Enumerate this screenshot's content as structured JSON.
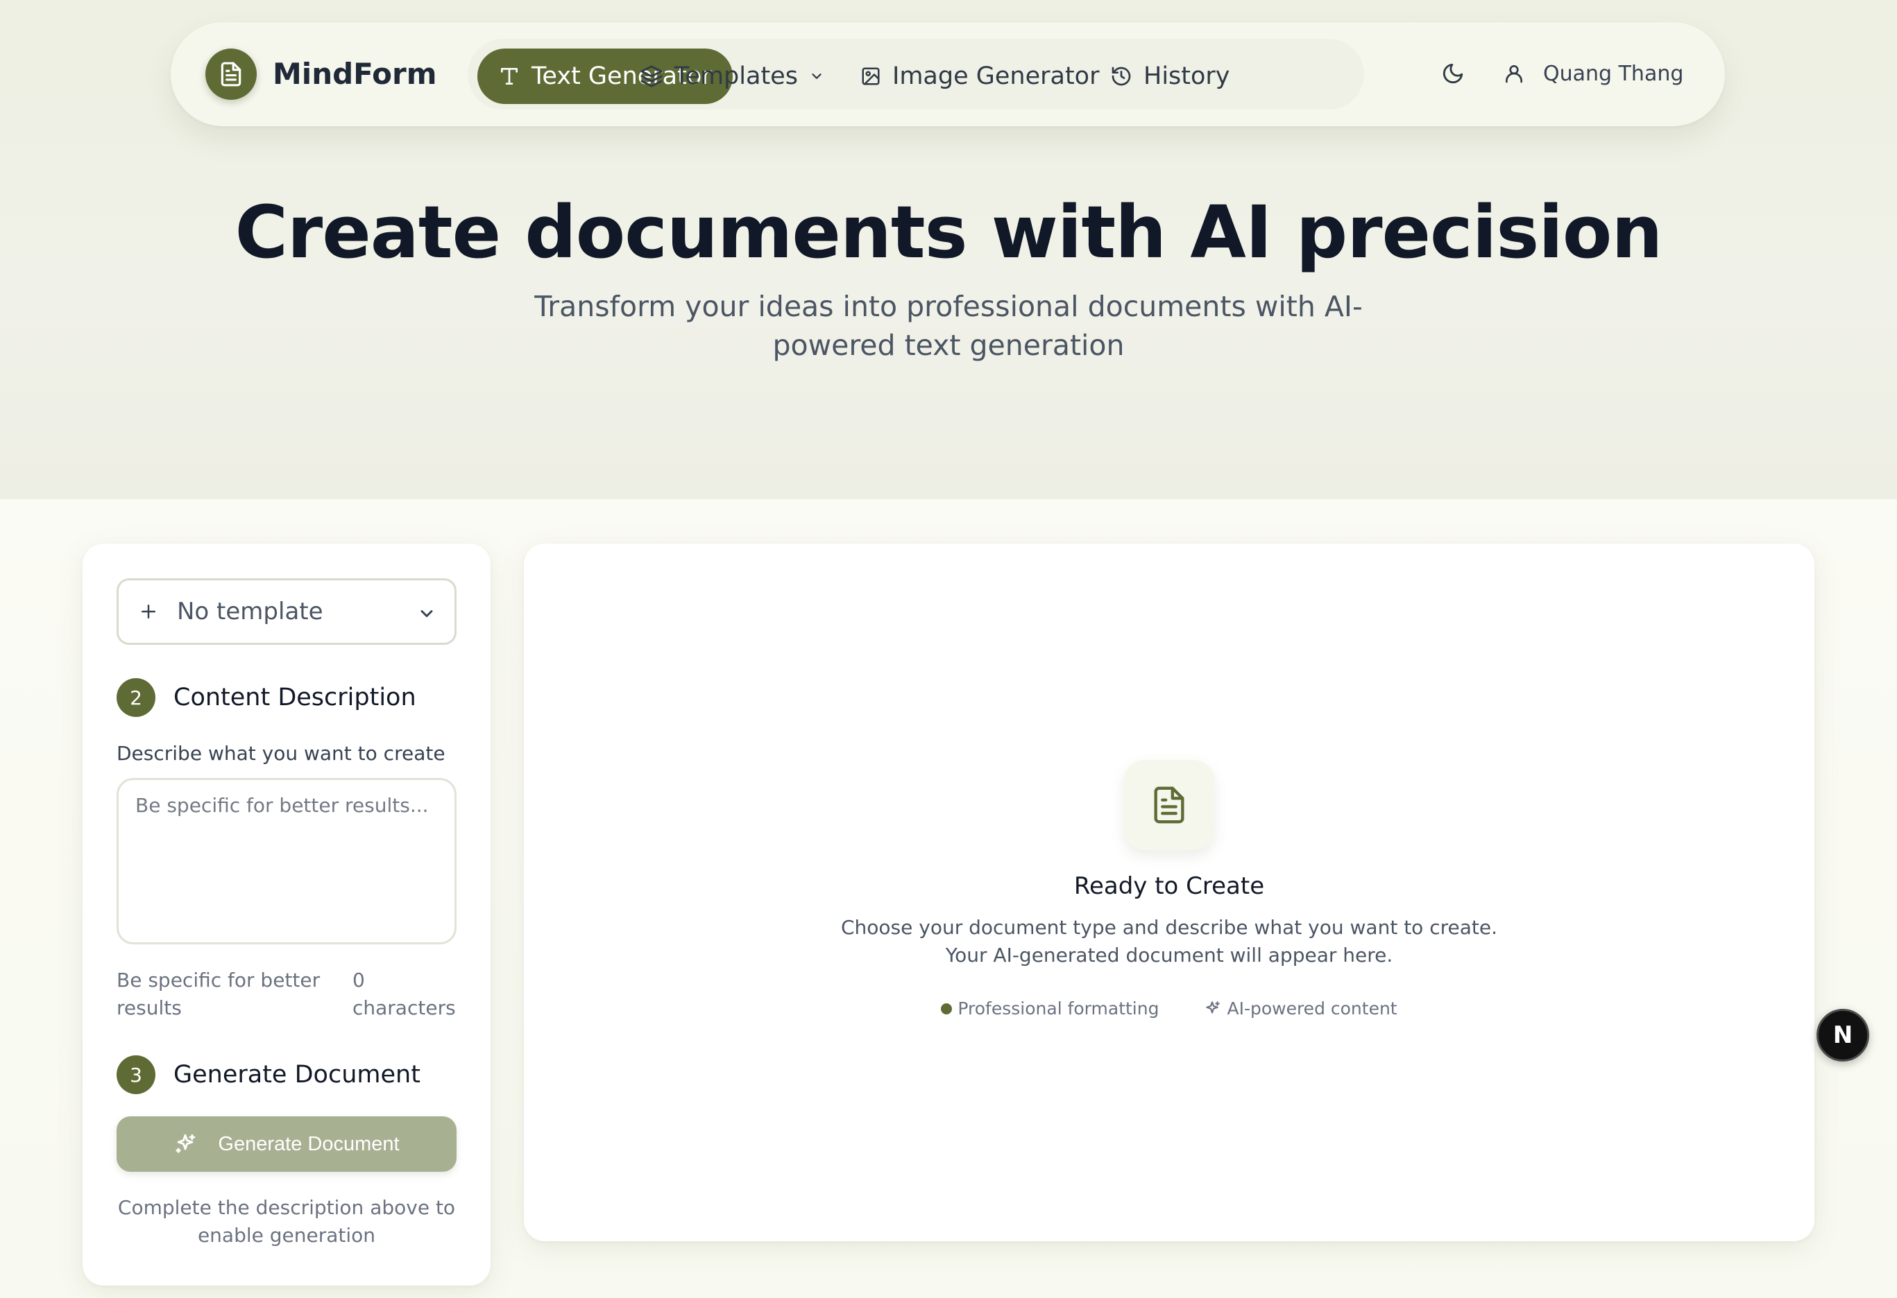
{
  "brand": {
    "name": "MindForm",
    "logo_icon": "document-icon"
  },
  "nav": {
    "items": [
      {
        "label": "Text Generator",
        "icon": "text-icon",
        "active": true
      },
      {
        "label": "Templates",
        "icon": "layers-icon",
        "dropdown": true
      },
      {
        "label": "Image Generator",
        "icon": "image-icon"
      },
      {
        "label": "History",
        "icon": "history-icon"
      }
    ],
    "theme_icon": "moon-icon",
    "user": {
      "name": "Quang Thang",
      "icon": "user-icon"
    }
  },
  "hero": {
    "title": "Create documents with AI precision",
    "subtitle": "Transform your ideas into professional documents with AI-powered text generation"
  },
  "panel": {
    "template_select": {
      "value": "No template"
    },
    "step2": {
      "number": "2",
      "title": "Content Description"
    },
    "field_label": "Describe what you want to create",
    "textarea_placeholder": "Be specific for better results...",
    "hint": "Be specific for better results",
    "char_count": "0 characters",
    "step3": {
      "number": "3",
      "title": "Generate Document"
    },
    "generate_label": "Generate Document",
    "generate_note": "Complete the description above to enable generation"
  },
  "output": {
    "title": "Ready to Create",
    "description_line1": "Choose your document type and describe what you want to create.",
    "description_line2": "Your AI-generated document will appear here.",
    "features": [
      "Professional formatting",
      "AI-powered content"
    ]
  },
  "badge": {
    "label": "N"
  },
  "colors": {
    "accent": "#5e6b35",
    "button_disabled": "#a8b092",
    "background": "#f6f7ee"
  }
}
